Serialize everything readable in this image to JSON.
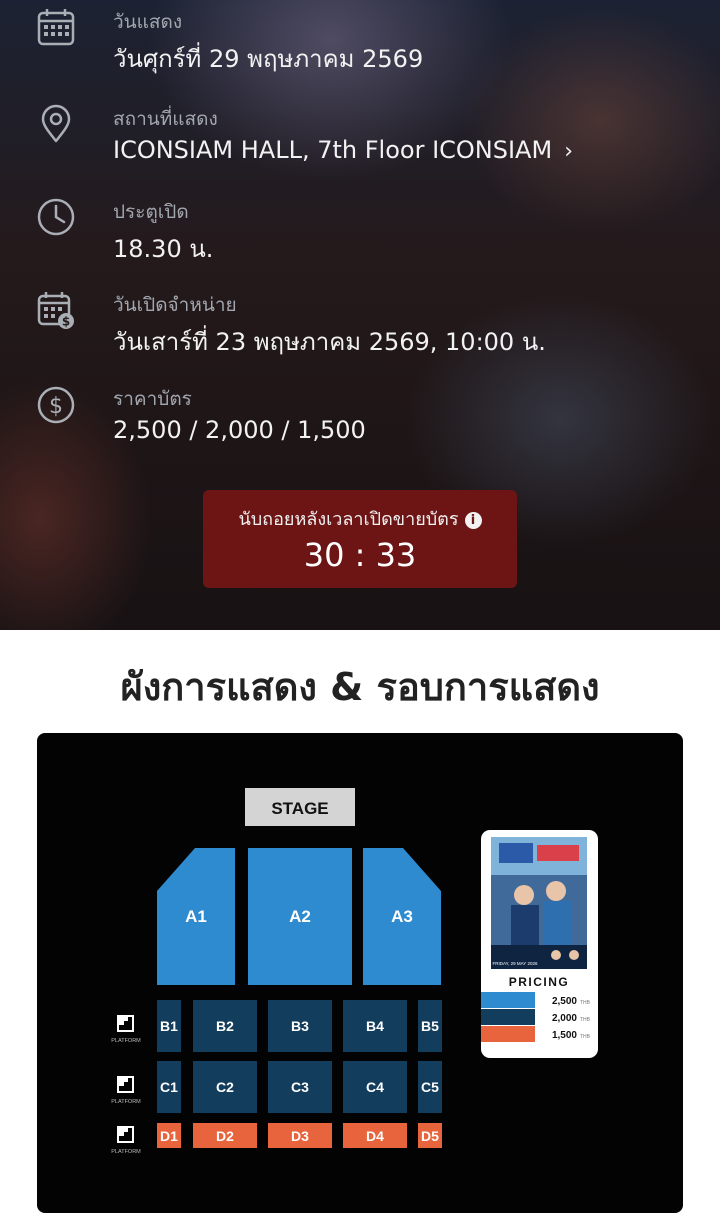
{
  "event_info": {
    "show_date": {
      "icon": "calendar-icon",
      "label": "วันแสดง",
      "value": "วันศุกร์ที่ 29 พฤษภาคม 2569"
    },
    "venue": {
      "icon": "location-pin-icon",
      "label": "สถานที่แสดง",
      "value": "ICONSIAM HALL, 7th Floor ICONSIAM",
      "chevron": "›"
    },
    "door_open": {
      "icon": "clock-icon",
      "label": "ประตูเปิด",
      "value": "18.30 น."
    },
    "sale_open": {
      "icon": "calendar-money-icon",
      "label": "วันเปิดจำหน่าย",
      "value": "วันเสาร์ที่ 23 พฤษภาคม 2569, 10:00 น."
    },
    "price": {
      "icon": "dollar-icon",
      "label": "ราคาบัตร",
      "value": "2,500 / 2,000 / 1,500"
    }
  },
  "countdown": {
    "label": "นับถอยหลังเวลาเปิดขายบัตร",
    "info_icon": "i",
    "time": "30 : 33"
  },
  "section": {
    "title": "ผังการแสดง & รอบการแสดง"
  },
  "seat_map": {
    "stage_label": "STAGE",
    "platform_label": "PLATFORM",
    "zones_a": [
      "A1",
      "A2",
      "A3"
    ],
    "zones_b": [
      "B1",
      "B2",
      "B3",
      "B4",
      "B5"
    ],
    "zones_c": [
      "C1",
      "C2",
      "C3",
      "C4",
      "C5"
    ],
    "zones_d": [
      "D1",
      "D2",
      "D3",
      "D4",
      "D5"
    ],
    "pricing": {
      "title": "PRICING",
      "currency": "THB",
      "tiers": [
        {
          "price": "2,500",
          "color": "#2e8bd0"
        },
        {
          "price": "2,000",
          "color": "#123d5c"
        },
        {
          "price": "1,500",
          "color": "#e8643c"
        }
      ],
      "poster_text": "FRIDAY, 29 MAY 2026"
    },
    "colors": {
      "zone_a": "#2e8bd0",
      "zone_bc": "#123d5c",
      "zone_d": "#e8643c",
      "stage": "#d4d4d4"
    }
  }
}
